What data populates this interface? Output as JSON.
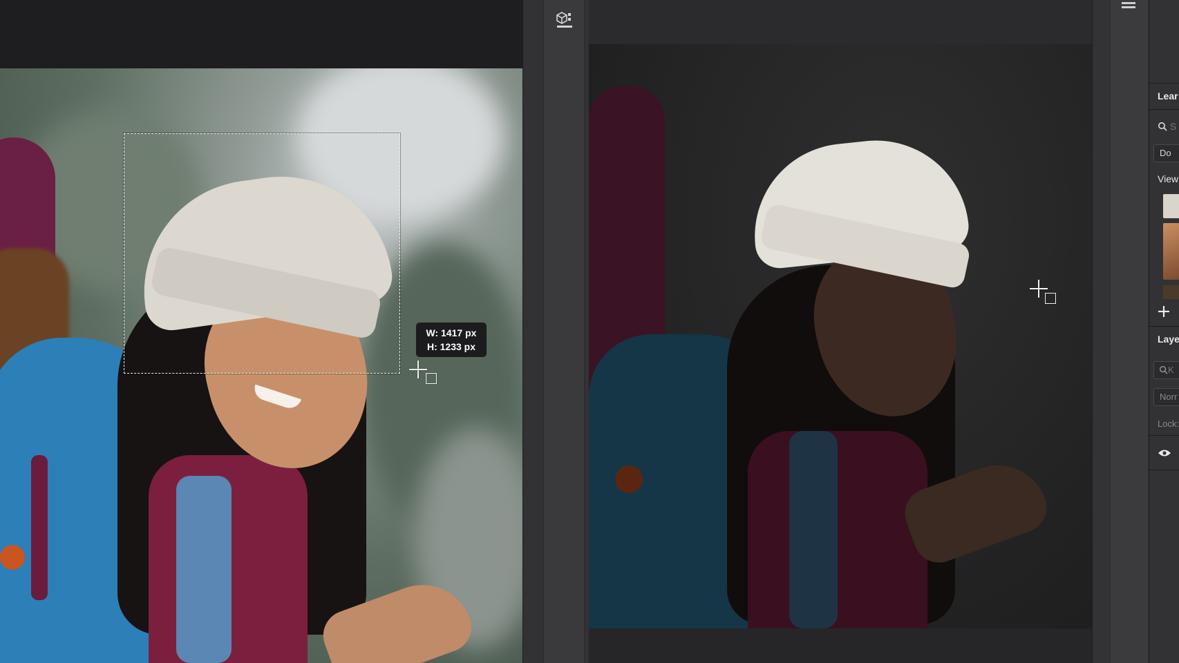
{
  "canvas_left": {
    "selection_tooltip": {
      "width_text": "W: 1417 px",
      "height_text": "H: 1233 px"
    }
  },
  "right_panel": {
    "learn_heading": "Lear",
    "search_placeholder": "S",
    "dropdown_value": "Do",
    "view_label": "View",
    "layers_heading": "Laye",
    "layers_search_placeholder": "K",
    "blend_mode_value": "Norr",
    "lock_label": "Lock:"
  },
  "icons": {
    "panel_toggle": "cube-panel-icon",
    "search": "search-icon",
    "add": "plus-icon",
    "visibility": "eye-icon"
  }
}
